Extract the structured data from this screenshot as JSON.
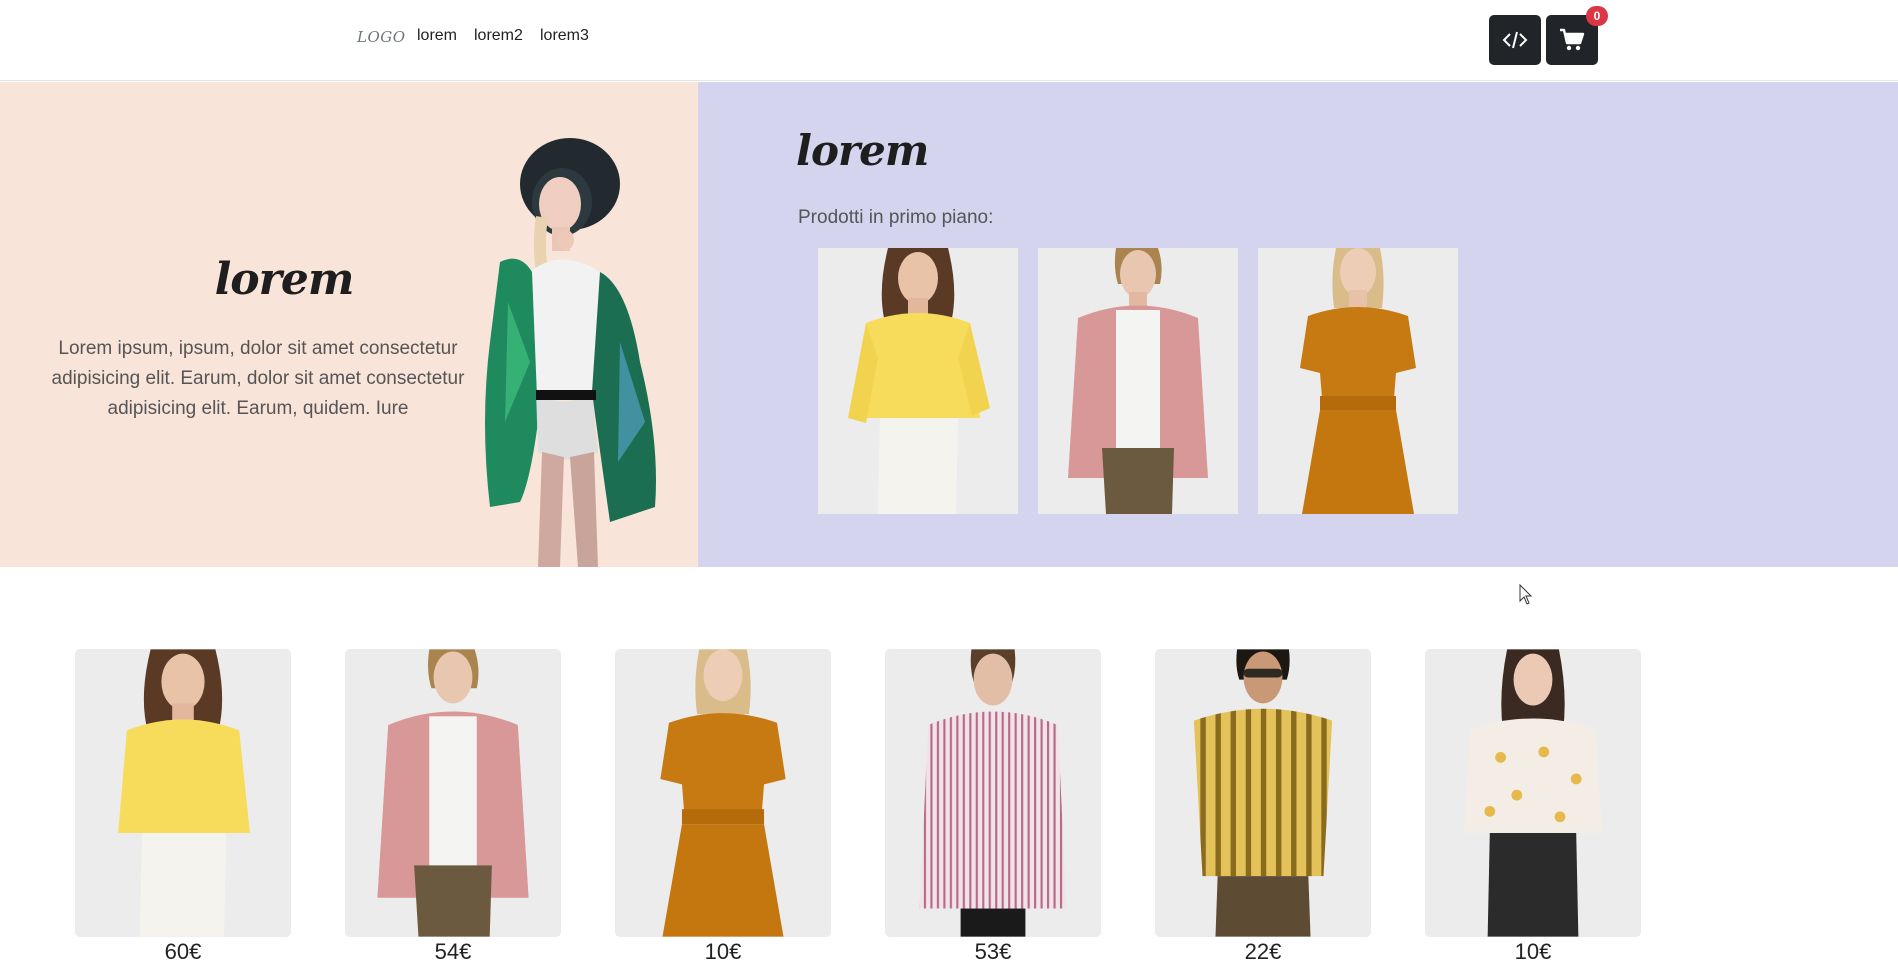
{
  "navbar": {
    "logo": "LOGO",
    "links": [
      "lorem",
      "lorem2",
      "lorem3"
    ],
    "code_icon": "code-icon",
    "cart_icon": "cart-icon",
    "cart_count": "0"
  },
  "hero": {
    "title": "lorem",
    "text": "Lorem ipsum, ipsum, dolor sit amet consectetur adipisicing elit. Earum, dolor sit amet consectetur adipisicing elit. Earum, quidem. Iure",
    "bg_left": "#f9e4da",
    "bg_right": "#d4d4ef"
  },
  "featured": {
    "title": "lorem",
    "label": "Prodotti in primo piano:",
    "items": [
      "yellow-blouse",
      "pink-shirt",
      "orange-dress"
    ]
  },
  "products": [
    {
      "image": "yellow-blouse",
      "price": "60€"
    },
    {
      "image": "pink-shirt",
      "price": "54€"
    },
    {
      "image": "orange-dress",
      "price": "10€"
    },
    {
      "image": "striped-shirt",
      "price": "53€"
    },
    {
      "image": "yellow-stripe-shirt",
      "price": "22€"
    },
    {
      "image": "floral-blouse",
      "price": "10€"
    }
  ]
}
